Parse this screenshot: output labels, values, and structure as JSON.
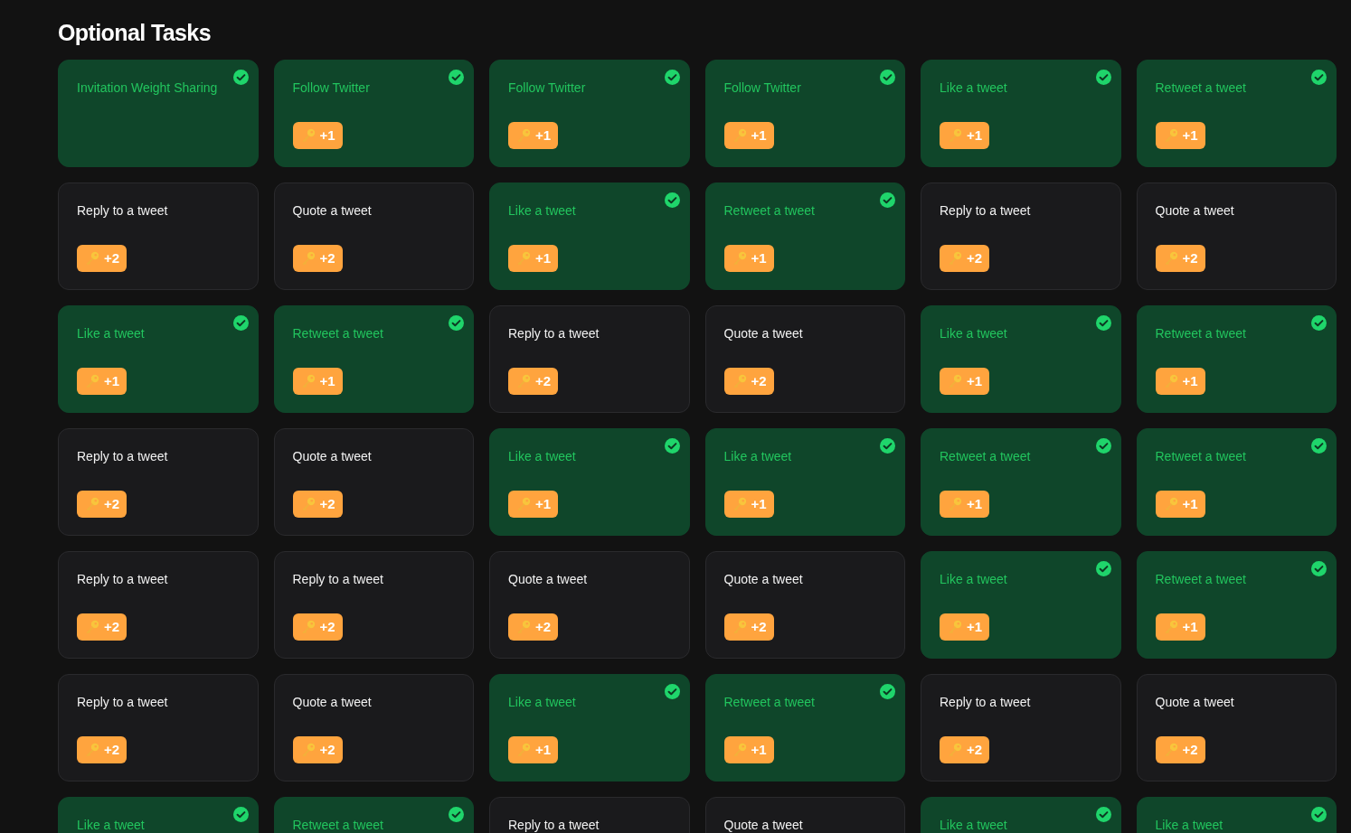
{
  "title": "Optional Tasks",
  "tasks": [
    {
      "title": "Invitation Weight Sharing",
      "completed": true
    },
    {
      "title": "Follow Twitter",
      "completed": true,
      "reward": "+1"
    },
    {
      "title": "Follow Twitter",
      "completed": true,
      "reward": "+1"
    },
    {
      "title": "Follow Twitter",
      "completed": true,
      "reward": "+1"
    },
    {
      "title": "Like a tweet",
      "completed": true,
      "reward": "+1"
    },
    {
      "title": "Retweet a tweet",
      "completed": true,
      "reward": "+1"
    },
    {
      "title": "Reply to a tweet",
      "completed": false,
      "reward": "+2"
    },
    {
      "title": "Quote a tweet",
      "completed": false,
      "reward": "+2"
    },
    {
      "title": "Like a tweet",
      "completed": true,
      "reward": "+1"
    },
    {
      "title": "Retweet a tweet",
      "completed": true,
      "reward": "+1"
    },
    {
      "title": "Reply to a tweet",
      "completed": false,
      "reward": "+2"
    },
    {
      "title": "Quote a tweet",
      "completed": false,
      "reward": "+2"
    },
    {
      "title": "Like a tweet",
      "completed": true,
      "reward": "+1"
    },
    {
      "title": "Retweet a tweet",
      "completed": true,
      "reward": "+1"
    },
    {
      "title": "Reply to a tweet",
      "completed": false,
      "reward": "+2"
    },
    {
      "title": "Quote a tweet",
      "completed": false,
      "reward": "+2"
    },
    {
      "title": "Like a tweet",
      "completed": true,
      "reward": "+1"
    },
    {
      "title": "Retweet a tweet",
      "completed": true,
      "reward": "+1"
    },
    {
      "title": "Reply to a tweet",
      "completed": false,
      "reward": "+2"
    },
    {
      "title": "Quote a tweet",
      "completed": false,
      "reward": "+2"
    },
    {
      "title": "Like a tweet",
      "completed": true,
      "reward": "+1"
    },
    {
      "title": "Like a tweet",
      "completed": true,
      "reward": "+1"
    },
    {
      "title": "Retweet a tweet",
      "completed": true,
      "reward": "+1"
    },
    {
      "title": "Retweet a tweet",
      "completed": true,
      "reward": "+1"
    },
    {
      "title": "Reply to a tweet",
      "completed": false,
      "reward": "+2"
    },
    {
      "title": "Reply to a tweet",
      "completed": false,
      "reward": "+2"
    },
    {
      "title": "Quote a tweet",
      "completed": false,
      "reward": "+2"
    },
    {
      "title": "Quote a tweet",
      "completed": false,
      "reward": "+2"
    },
    {
      "title": "Like a tweet",
      "completed": true,
      "reward": "+1"
    },
    {
      "title": "Retweet a tweet",
      "completed": true,
      "reward": "+1"
    },
    {
      "title": "Reply to a tweet",
      "completed": false,
      "reward": "+2"
    },
    {
      "title": "Quote a tweet",
      "completed": false,
      "reward": "+2"
    },
    {
      "title": "Like a tweet",
      "completed": true,
      "reward": "+1"
    },
    {
      "title": "Retweet a tweet",
      "completed": true,
      "reward": "+1"
    },
    {
      "title": "Reply to a tweet",
      "completed": false,
      "reward": "+2"
    },
    {
      "title": "Quote a tweet",
      "completed": false,
      "reward": "+2"
    },
    {
      "title": "Like a tweet",
      "completed": true
    },
    {
      "title": "Retweet a tweet",
      "completed": true
    },
    {
      "title": "Reply to a tweet",
      "completed": false
    },
    {
      "title": "Quote a tweet",
      "completed": false
    },
    {
      "title": "Like a tweet",
      "completed": true
    },
    {
      "title": "Like a tweet",
      "completed": true
    }
  ]
}
